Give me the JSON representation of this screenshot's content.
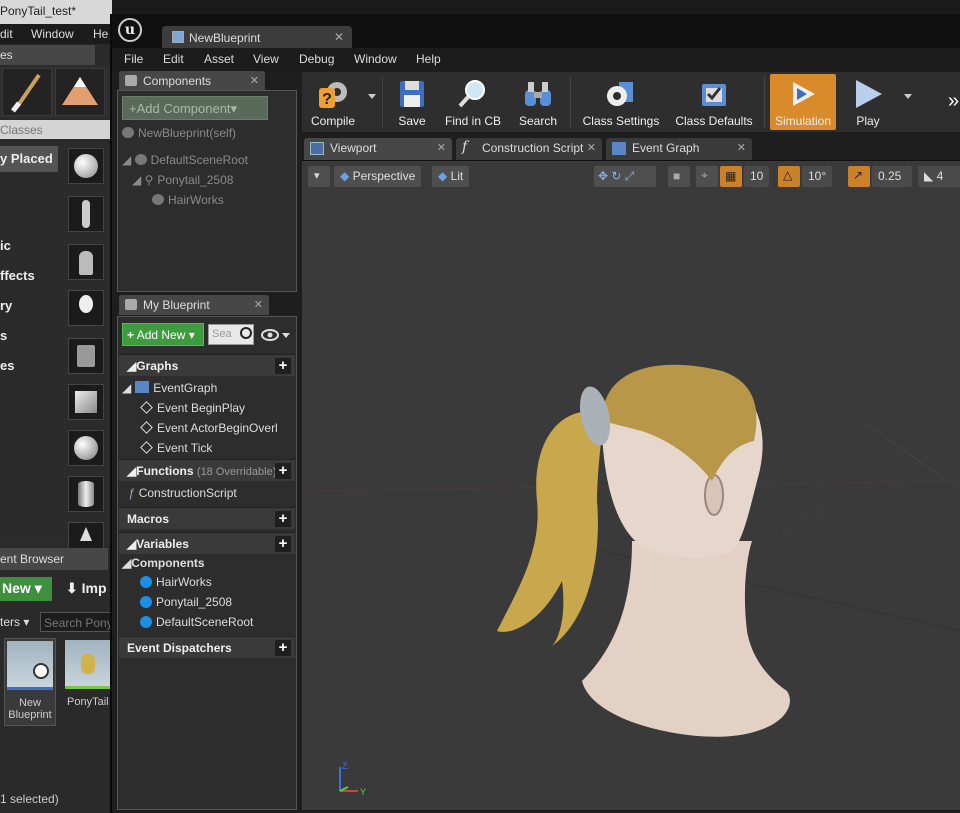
{
  "bg_editor": {
    "title": "PonyTail_test*",
    "menu": [
      "dit",
      "Window",
      "He"
    ],
    "modes_tab": "es",
    "search_classes_placeholder": "Classes",
    "categories": [
      "y Placed",
      "ic",
      "ffects",
      "ry",
      "s",
      "es"
    ],
    "content_browser_tab": "ent Browser",
    "new_label": "New",
    "import_label": "Imp",
    "filters_label": "ters",
    "search_placeholder": "Search Pony",
    "assets": [
      {
        "name": "New Blueprint",
        "bar": "#3b6fc4"
      },
      {
        "name": "PonyTail",
        "bar": "#7cc63a"
      }
    ],
    "status": "1 selected)"
  },
  "window": {
    "tab_title": "NewBlueprint",
    "menu": [
      "File",
      "Edit",
      "Asset",
      "View",
      "Debug",
      "Window",
      "Help"
    ]
  },
  "components": {
    "tab": "Components",
    "add_button": "+Add Component",
    "self_item": "NewBlueprint(self)",
    "tree": [
      {
        "label": "DefaultSceneRoot",
        "indent": 0
      },
      {
        "label": "Ponytail_2508",
        "indent": 1
      },
      {
        "label": "HairWorks",
        "indent": 2
      }
    ]
  },
  "my_blueprint": {
    "tab": "My Blueprint",
    "add_new": "Add New",
    "search_placeholder": "Sea",
    "sections": {
      "graphs": "Graphs",
      "functions": "Functions",
      "functions_sub": "(18 Overridable)",
      "macros": "Macros",
      "variables": "Variables",
      "event_dispatchers": "Event Dispatchers"
    },
    "event_graph": "EventGraph",
    "events": [
      "Event BeginPlay",
      "Event ActorBeginOverl",
      "Event Tick"
    ],
    "functions": [
      "ConstructionScript"
    ],
    "variables_category": "Components",
    "variables": [
      "HairWorks",
      "Ponytail_2508",
      "DefaultSceneRoot"
    ]
  },
  "toolbar": {
    "buttons": [
      "Compile",
      "Save",
      "Find in CB",
      "Search",
      "Class Settings",
      "Class Defaults",
      "Simulation",
      "Play"
    ],
    "active_color": "#d98a2a"
  },
  "editor_tabs": [
    "Viewport",
    "Construction Script",
    "Event Graph"
  ],
  "viewport": {
    "perspective": "Perspective",
    "lit": "Lit",
    "grid_snap": "10",
    "rotation_snap": "10°",
    "scale_snap": "0.25",
    "camera_speed": "4"
  }
}
